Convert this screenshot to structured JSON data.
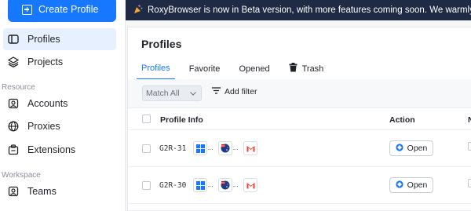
{
  "sidebar": {
    "create_button": "Create Profile",
    "items": [
      {
        "label": "Profiles",
        "icon": "profiles-icon",
        "active": true
      },
      {
        "label": "Projects",
        "icon": "layers-icon"
      },
      {
        "label": "Accounts",
        "icon": "account-icon"
      },
      {
        "label": "Proxies",
        "icon": "globe-icon"
      },
      {
        "label": "Extensions",
        "icon": "extension-icon"
      },
      {
        "label": "Teams",
        "icon": "team-icon"
      }
    ],
    "sections": {
      "resource": "Resource",
      "workspace": "Workspace"
    }
  },
  "banner": {
    "text": "RoxyBrowser is now in Beta version, with more features coming soon. We warmly invi"
  },
  "main": {
    "title": "Profiles",
    "tabs": [
      {
        "label": "Profiles",
        "active": true
      },
      {
        "label": "Favorite"
      },
      {
        "label": "Opened"
      },
      {
        "label": "Trash",
        "icon": "trash-icon"
      }
    ],
    "toolbar": {
      "match_value": "Match All",
      "add_filter": "Add filter"
    },
    "table": {
      "headers": {
        "profile_info": "Profile Info",
        "action": "Action",
        "truncated": "N"
      },
      "rows": [
        {
          "code": "G2R-31",
          "action": "Open",
          "badges": [
            "windows-icon",
            "country-flag-icon",
            "gmail-icon"
          ]
        },
        {
          "code": "G2R-30",
          "action": "Open",
          "badges": [
            "windows-icon",
            "country-flag-icon",
            "gmail-icon"
          ]
        }
      ]
    }
  },
  "colors": {
    "accent": "#1677ff",
    "banner_bg": "#1f2a44",
    "active_bg": "#e6f0ff"
  }
}
